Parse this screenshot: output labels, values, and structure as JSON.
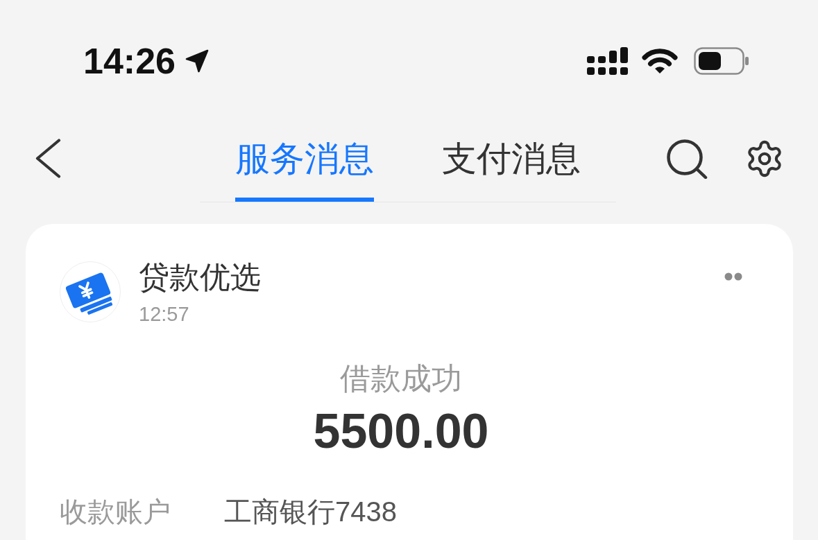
{
  "status_bar": {
    "time": "14:26"
  },
  "nav": {
    "tabs": [
      {
        "label": "服务消息",
        "selected": true
      },
      {
        "label": "支付消息",
        "selected": false
      }
    ]
  },
  "message_card": {
    "sender": "贷款优选",
    "time": "12:57",
    "title": "借款成功",
    "amount": "5500.00",
    "fields": [
      {
        "label": "收款账户",
        "value": "工商银行7438"
      }
    ]
  }
}
